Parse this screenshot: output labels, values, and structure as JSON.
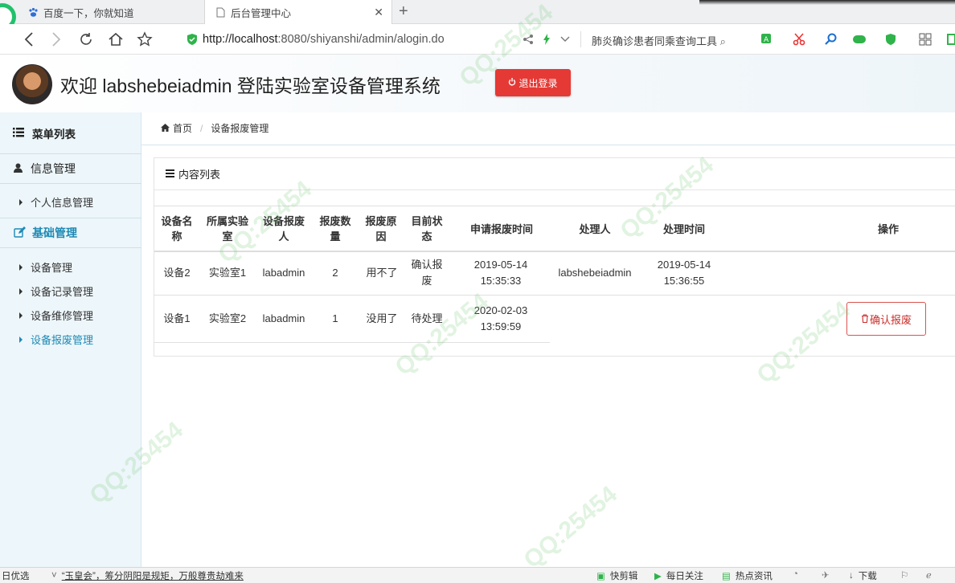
{
  "browser": {
    "tabs": [
      {
        "label": "百度一下，你就知道"
      },
      {
        "label": "后台管理中心"
      }
    ],
    "new_tab": "+",
    "url_host": "http://localhost",
    "url_rest": ":8080/shiyanshi/admin/alogin.do",
    "search_hint": "肺炎确诊患者同乘查询工具"
  },
  "header": {
    "welcome": "欢迎 labshebeiadmin 登陆实验室设备管理系统",
    "logout_label": "退出登录"
  },
  "sidebar": {
    "title": "菜单列表",
    "sections": [
      {
        "label": "信息管理",
        "items": [
          "个人信息管理"
        ]
      },
      {
        "label": "基础管理",
        "items": [
          "设备管理",
          "设备记录管理",
          "设备维修管理",
          "设备报废管理"
        ]
      }
    ]
  },
  "breadcrumb": {
    "home": "首页",
    "current": "设备报废管理"
  },
  "panel": {
    "title": "内容列表"
  },
  "table": {
    "headers": [
      "设备名称",
      "所属实验室",
      "设备报废人",
      "报废数量",
      "报废原因",
      "目前状态",
      "申请报废时间",
      "处理人",
      "处理时间",
      "操作"
    ],
    "rows": [
      {
        "name": "设备2",
        "lab": "实验室1",
        "person": "labadmin",
        "qty": "2",
        "reason": "用不了",
        "status": "确认报废",
        "apply_time": "2019-05-14 15:35:33",
        "handler": "labshebeiadmin",
        "handle_time": "2019-05-14 15:36:55",
        "action": ""
      },
      {
        "name": "设备1",
        "lab": "实验室2",
        "person": "labadmin",
        "qty": "1",
        "reason": "没用了",
        "status": "待处理",
        "apply_time": "2020-02-03 13:59:59",
        "handler": "",
        "handle_time": "",
        "action": "确认报废"
      }
    ]
  },
  "statusbar": {
    "left": "日优选",
    "news": "“玉皇会”，筹分阴阳是规矩，万般尊贵劫难来",
    "items": [
      "快剪辑",
      "每日关注",
      "热点资讯",
      "下载"
    ]
  },
  "colors": {
    "accent": "#1e8ab5",
    "logout": "#e53935",
    "danger": "#d9534f"
  }
}
